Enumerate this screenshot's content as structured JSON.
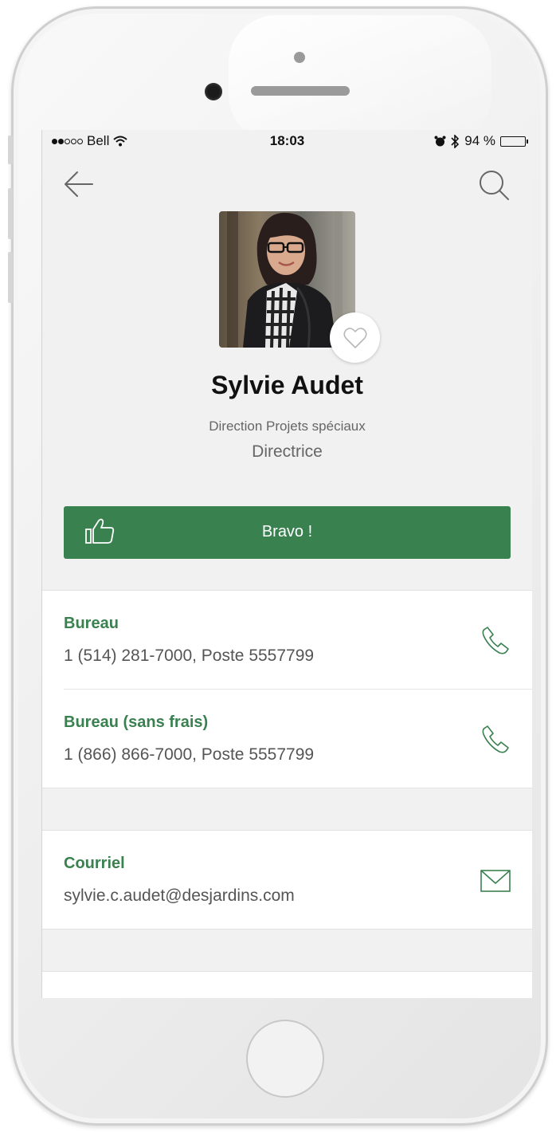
{
  "status_bar": {
    "carrier": "Bell",
    "time": "18:03",
    "battery_percent": "94 %",
    "battery_level": 0.94,
    "signal_bars_filled": 2,
    "signal_bars_total": 5
  },
  "nav": {
    "back_icon": "arrow-left-icon",
    "search_icon": "search-icon"
  },
  "profile": {
    "name": "Sylvie Audet",
    "department": "Direction Projets spéciaux",
    "title": "Directrice",
    "favorite_icon": "heart-outline-icon"
  },
  "bravo": {
    "label": "Bravo !",
    "icon": "thumbs-up-icon"
  },
  "contacts": [
    {
      "label": "Bureau",
      "value": "1 (514) 281-7000, Poste 5557799",
      "action_icon": "phone-icon"
    },
    {
      "label": "Bureau (sans frais)",
      "value": "1 (866) 866-7000, Poste 5557799",
      "action_icon": "phone-icon"
    }
  ],
  "email": {
    "label": "Courriel",
    "value": "sylvie.c.audet@desjardins.com",
    "action_icon": "mail-icon"
  },
  "colors": {
    "accent_green": "#3a8150",
    "screen_background": "#f1f1f1"
  }
}
